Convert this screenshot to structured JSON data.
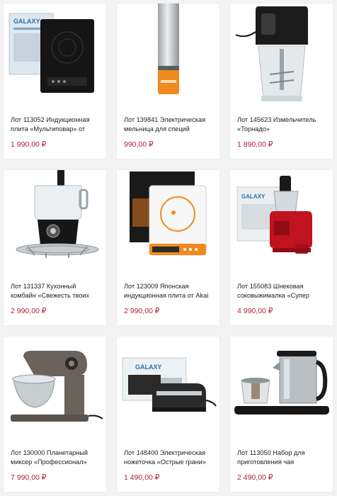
{
  "products": [
    {
      "title": "Лот 113052 Индукционная плита «Мультиповар» от",
      "price": "1 990,00 ₽",
      "image_brand": "GALAXY",
      "image_icon": "induction-cooktop-icon"
    },
    {
      "title": "Лот 139841 Электрическая мельница для специй",
      "price": "990,00 ₽",
      "image_icon": "spice-grinder-icon"
    },
    {
      "title": "Лот 145623 Измельчитель «Торнадо»",
      "price": "1 890,00 ₽",
      "image_icon": "chopper-icon"
    },
    {
      "title": "Лот 131337 Кухонный комбайн «Свежесть твоих",
      "price": "2 990,00 ₽",
      "image_icon": "food-processor-icon"
    },
    {
      "title": "Лот 123009 Японская индукционная плита от Akai",
      "price": "2 990,00 ₽",
      "image_icon": "induction-cooktop-icon"
    },
    {
      "title": "Лот 155083 Шнековая соковыжималка «Супер",
      "price": "4 990,00 ₽",
      "image_brand": "GALAXY",
      "image_icon": "juicer-icon"
    },
    {
      "title": "Лот 130000 Планетарный миксер «Профессионал»",
      "price": "7 990,00 ₽",
      "image_icon": "stand-mixer-icon"
    },
    {
      "title": "Лот 148400 Электрическая ножеточка «Острые грани»",
      "price": "1 490,00 ₽",
      "image_brand": "GALAXY",
      "image_icon": "knife-sharpener-icon"
    },
    {
      "title": "Лот 113050 Набор для приготовления чая",
      "price": "2 490,00 ₽",
      "image_icon": "tea-set-icon"
    }
  ],
  "colors": {
    "price": "#b0213b",
    "background": "#f3f3f3"
  }
}
